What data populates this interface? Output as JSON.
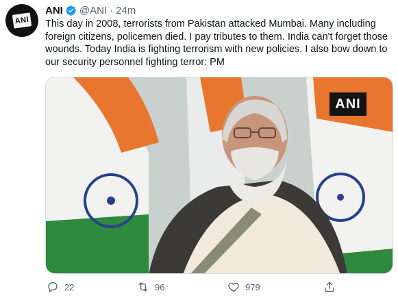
{
  "tweet": {
    "author_name": "ANI",
    "handle": "@ANI",
    "separator": "·",
    "time": "24m",
    "text": "This day in 2008, terrorists from Pakistan attacked Mumbai. Many including foreign citizens, policemen died. I pay tributes to them. India can't forget those wounds. Today India is fighting terrorism with new policies. I also bow down to our security personnel fighting terror: PM"
  },
  "avatar": {
    "logo_text": "ANI"
  },
  "media": {
    "watermark": "ANI"
  },
  "actions": {
    "replies": "22",
    "retweets": "96",
    "likes": "979"
  },
  "icons": {
    "reply": "reply-icon",
    "retweet": "retweet-icon",
    "like": "heart-icon",
    "share": "share-icon",
    "verified": "verified-badge-icon"
  },
  "colors": {
    "text": "#0f1419",
    "secondary": "#536471",
    "verified_blue": "#1d9bf0"
  }
}
